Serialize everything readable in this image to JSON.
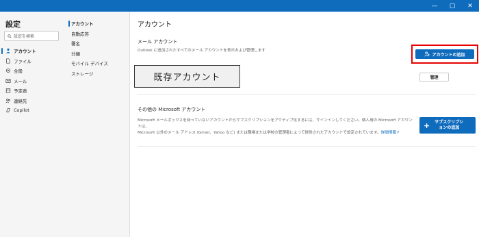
{
  "window": {
    "controls": [
      "—",
      "▢",
      "✕"
    ]
  },
  "sidebar": {
    "title": "設定",
    "search_placeholder": "設定を検索",
    "items": [
      {
        "label": "アカウント",
        "icon": "person-icon"
      },
      {
        "label": "ファイル",
        "icon": "file-icon"
      },
      {
        "label": "全般",
        "icon": "gear-icon"
      },
      {
        "label": "メール",
        "icon": "mail-icon"
      },
      {
        "label": "予定表",
        "icon": "calendar-icon"
      },
      {
        "label": "連絡先",
        "icon": "people-icon"
      },
      {
        "label": "Copilot",
        "icon": "copilot-icon"
      }
    ],
    "subitems": [
      "アカウント",
      "自動応答",
      "署名",
      "分類",
      "モバイル デバイス",
      "ストレージ"
    ]
  },
  "main": {
    "title": "アカウント",
    "mail_section": {
      "heading": "メール アカウント",
      "description": "Outlook に追加されたすべてのメール アカウントを表示および管理します",
      "add_button": "アカウントの追加",
      "existing_label": "既存アカウント",
      "manage_button": "管理"
    },
    "ms_section": {
      "heading": "その他の Microsoft アカウント",
      "description_line1": "Microsoft メールボックスを持っていないアカウントからサブスクリプションをアクティブ化するには、サインインしてください。個人用の Microsoft アカウントは、",
      "description_line2": "Microsoft 以外のメール アドレス (Gmail、Yahoo など) または職場または学校の管理者によって提供されたアカウントで設定されています。",
      "learn_more": "詳細情報",
      "add_sub_button_line1": "サブスクリプシ",
      "add_sub_button_line2": "ョンの追加"
    }
  },
  "colors": {
    "accent": "#0f6cbd",
    "highlight": "#e60000"
  }
}
